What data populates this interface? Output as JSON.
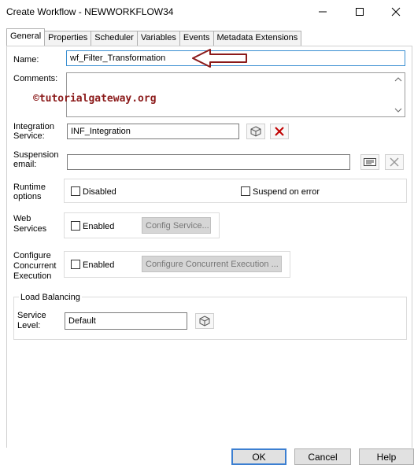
{
  "window": {
    "title": "Create Workflow - NEWWORKFLOW34"
  },
  "tabs": [
    "General",
    "Properties",
    "Scheduler",
    "Variables",
    "Events",
    "Metadata Extensions"
  ],
  "form": {
    "name_label": "Name:",
    "name_value": "wf_Filter_Transformation",
    "comments_label": "Comments:",
    "watermark": "©tutorialgateway.org",
    "integration_label_1": "Integration",
    "integration_label_2": "Service:",
    "integration_value": "INF_Integration",
    "suspension_label_1": "Suspension",
    "suspension_label_2": "email:",
    "suspension_value": "",
    "runtime_label_1": "Runtime",
    "runtime_label_2": "options",
    "disabled_label": "Disabled",
    "suspend_label": "Suspend on error",
    "web_label_1": "Web",
    "web_label_2": "Services",
    "web_enabled_label": "Enabled",
    "config_service_label": "Config Service...",
    "concurrent_label_1": "Configure",
    "concurrent_label_2": "Concurrent",
    "concurrent_label_3": "Execution",
    "concurrent_enabled_label": "Enabled",
    "configure_concurrent_label": "Configure Concurrent Execution ...",
    "load_balancing_label": "Load Balancing",
    "service_level_label_1": "Service",
    "service_level_label_2": "Level:",
    "service_level_value": "Default"
  },
  "buttons": {
    "ok": "OK",
    "cancel": "Cancel",
    "help": "Help"
  },
  "colors": {
    "arrow": "#8b1a1a",
    "accent": "#3c7fd1"
  },
  "icons": [
    "minimize-icon",
    "maximize-icon",
    "close-icon",
    "browse-integration-icon",
    "clear-icon",
    "email-icon",
    "browse-service-level-icon",
    "arrow-annotation"
  ]
}
